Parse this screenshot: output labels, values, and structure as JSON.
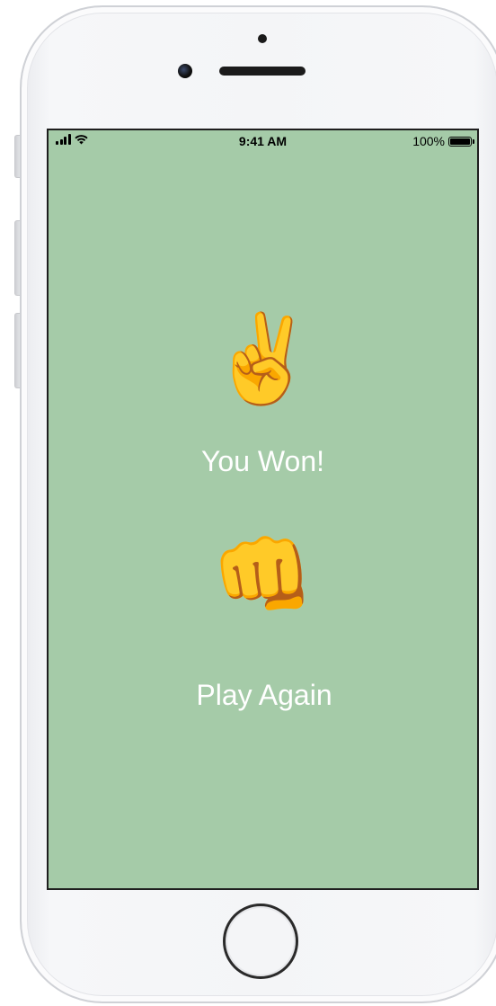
{
  "status_bar": {
    "time": "9:41 AM",
    "battery_percent": "100%",
    "battery_level": 1.0,
    "signal_icon": "cellular-signal-icon",
    "wifi_icon": "wifi-icon",
    "battery_icon": "battery-icon"
  },
  "game": {
    "computer_choice": "✌️",
    "computer_choice_icon": "victory-hand-icon",
    "result_text": "You Won!",
    "player_choice": "👊",
    "player_choice_icon": "oncoming-fist-icon",
    "play_again_label": "Play Again"
  },
  "colors": {
    "background": "#a5cba8",
    "text": "#ffffff"
  }
}
